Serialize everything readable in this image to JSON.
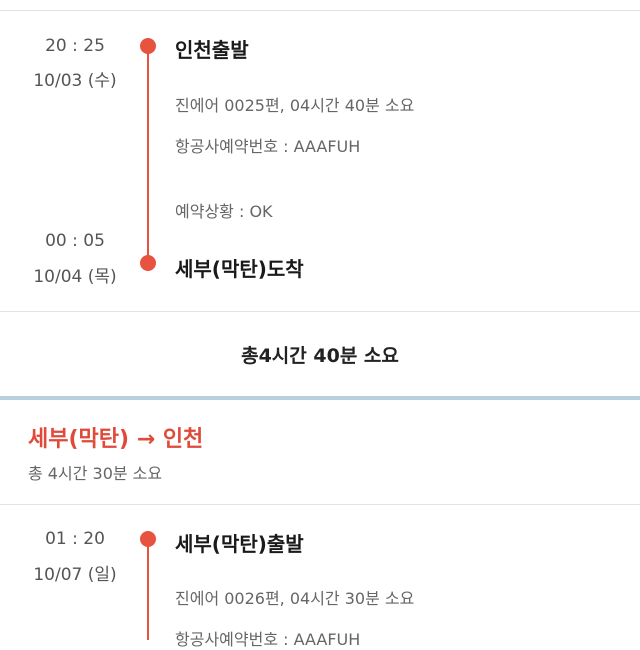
{
  "outbound": {
    "depart_time": "20 : 25",
    "depart_date": "10/03 (수)",
    "depart_place": "인천출발",
    "flight_info": "진에어 0025편, 04시간 40분 소요",
    "booking_ref": "항공사예약번호 : AAAFUH",
    "status": "예약상황 : OK",
    "arrive_time": "00 : 05",
    "arrive_date": "10/04 (목)",
    "arrive_place": "세부(막탄)도착",
    "total": "총4시간 40분 소요"
  },
  "return_route": {
    "title": "세부(막탄) → 인천",
    "total": "총 4시간 30분 소요"
  },
  "inbound": {
    "depart_time": "01 : 20",
    "depart_date": "10/07 (일)",
    "depart_place": "세부(막탄)출발",
    "flight_info": "진에어 0026편, 04시간 30분 소요",
    "booking_ref": "항공사예약번호 : AAAFUH"
  },
  "colors": {
    "accent": "#e8533f",
    "route_title": "#e04a3a",
    "divider": "#b8cfe0"
  }
}
